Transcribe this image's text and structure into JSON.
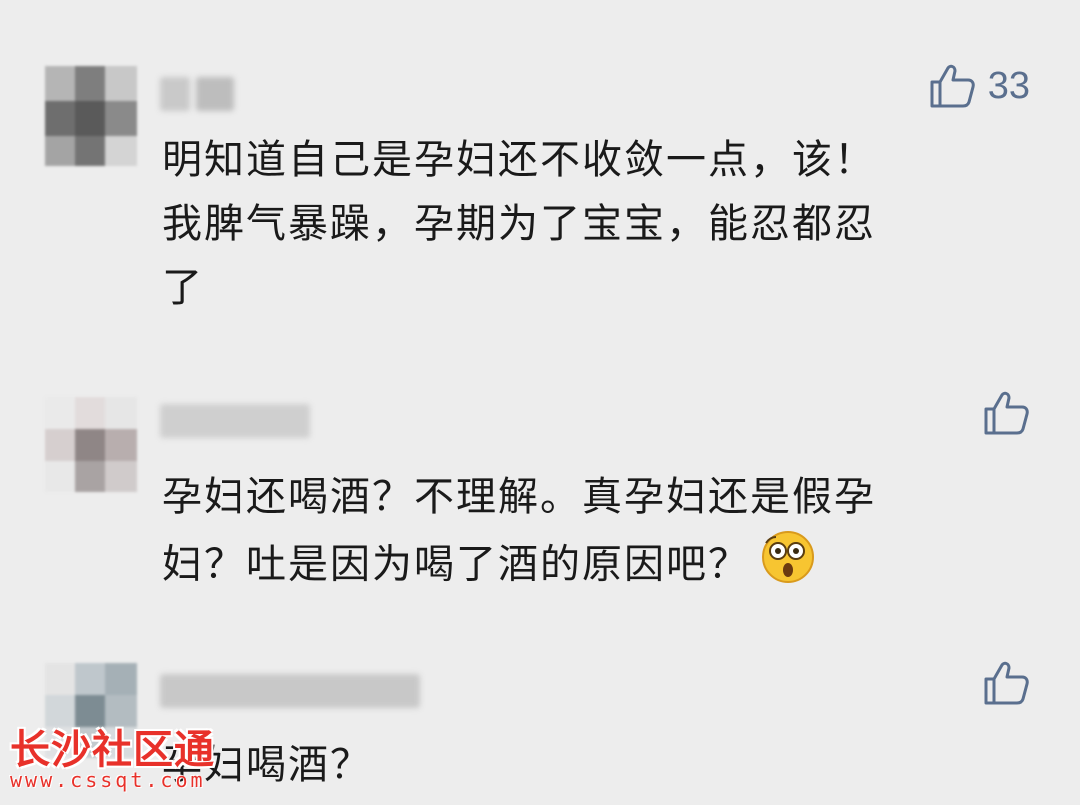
{
  "comments": [
    {
      "likes": "33",
      "text": "明知道自己是孕妇还不收敛一点，该！\n我脾气暴躁，孕期为了宝宝，能忍都忍\n了"
    },
    {
      "likes": "",
      "text": "孕妇还喝酒？不理解。真孕妇还是假孕\n妇？吐是因为喝了酒的原因吧？"
    },
    {
      "likes": "",
      "text": "孕妇喝酒？"
    }
  ],
  "watermark": {
    "title": "长沙社区通",
    "url": "www.cssqt.com"
  },
  "icons": {
    "like": "thumbs-up-icon",
    "emoji": "shocked-face-icon"
  },
  "colors": {
    "background": "#ededed",
    "like_icon": "#5a6f8e",
    "text": "#1a1a1a",
    "watermark": "#e8312a"
  }
}
